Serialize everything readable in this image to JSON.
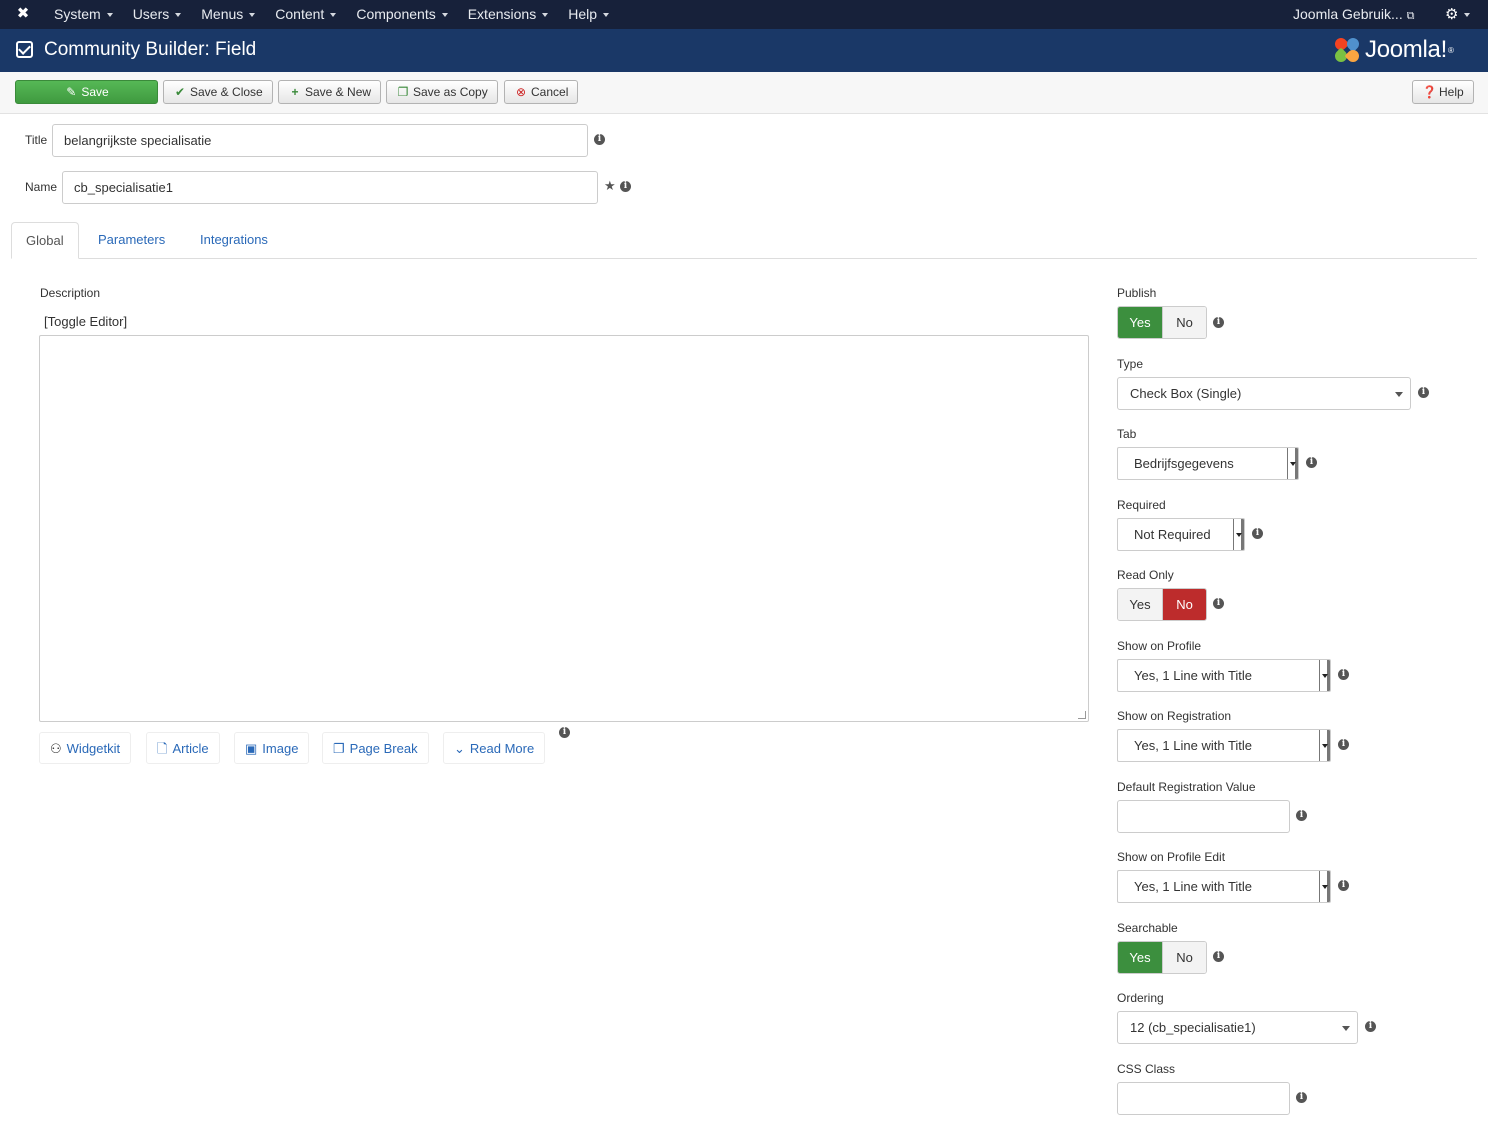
{
  "nav": {
    "items": [
      "System",
      "Users",
      "Menus",
      "Content",
      "Components",
      "Extensions",
      "Help"
    ],
    "user": "Joomla Gebruik...",
    "logo_icon": "joomla-logo-icon",
    "gear_icon": "gear-icon"
  },
  "header": {
    "title": "Community Builder: Field",
    "brand": "Joomla!",
    "brand_reg": "®"
  },
  "toolbar": {
    "save": "Save",
    "save_close": "Save & Close",
    "save_new": "Save & New",
    "save_copy": "Save as Copy",
    "cancel": "Cancel",
    "help": "Help"
  },
  "form": {
    "title_label": "Title",
    "title_value": "belangrijkste specialisatie",
    "name_label": "Name",
    "name_value": "cb_specialisatie1"
  },
  "tabs": [
    "Global",
    "Parameters",
    "Integrations"
  ],
  "description": {
    "label": "Description",
    "toggle": "[Toggle Editor]",
    "buttons": [
      "Widgetkit",
      "Article",
      "Image",
      "Page Break",
      "Read More"
    ]
  },
  "right": {
    "publish": {
      "label": "Publish",
      "yes": "Yes",
      "no": "No",
      "selected": "Yes"
    },
    "type": {
      "label": "Type",
      "value": "Check Box (Single)"
    },
    "tab": {
      "label": "Tab",
      "value": "Bedrijfsgegevens"
    },
    "required": {
      "label": "Required",
      "value": "Not Required"
    },
    "read_only": {
      "label": "Read Only",
      "yes": "Yes",
      "no": "No",
      "selected": "No"
    },
    "show_profile": {
      "label": "Show on Profile",
      "value": "Yes, 1 Line with Title"
    },
    "show_registration": {
      "label": "Show on Registration",
      "value": "Yes, 1 Line with Title"
    },
    "default_registration": {
      "label": "Default Registration Value",
      "value": ""
    },
    "show_profile_edit": {
      "label": "Show on Profile Edit",
      "value": "Yes, 1 Line with Title"
    },
    "searchable": {
      "label": "Searchable",
      "yes": "Yes",
      "no": "No",
      "selected": "Yes"
    },
    "ordering": {
      "label": "Ordering",
      "value": "12 (cb_specialisatie1)"
    },
    "css_class": {
      "label": "CSS Class",
      "value": ""
    }
  },
  "colors": {
    "navbar": "#17213a",
    "header": "#1a3867",
    "save_green": "#46a546",
    "yes_green": "#3c8f3e",
    "no_red": "#bd2c2c",
    "link_blue": "#2a69b8"
  }
}
